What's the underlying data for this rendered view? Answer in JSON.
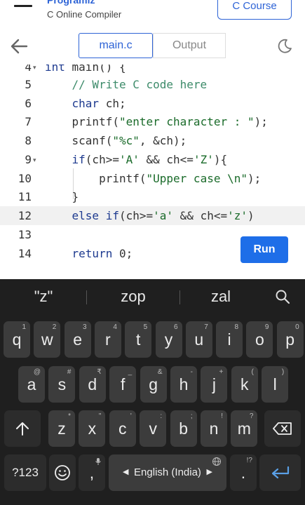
{
  "header": {
    "brand": "Programiz",
    "subtitle": "C Online Compiler",
    "course_button": "C Course"
  },
  "tabs": {
    "main": "main.c",
    "output": "Output"
  },
  "editor": {
    "lines": [
      {
        "n": "4",
        "fold": "▾",
        "code": "int main() {"
      },
      {
        "n": "5",
        "code": "    // Write C code here"
      },
      {
        "n": "6",
        "code": "    char ch;"
      },
      {
        "n": "7",
        "code": "    printf(\"enter character : \");"
      },
      {
        "n": "8",
        "code": "    scanf(\"%c\", &ch);"
      },
      {
        "n": "9",
        "fold": "▾",
        "code": "    if(ch>='A' && ch<='Z'){"
      },
      {
        "n": "10",
        "code": "        printf(\"Upper case \\n\");"
      },
      {
        "n": "11",
        "code": "    }"
      },
      {
        "n": "12",
        "code": "    else if(ch>='a' && ch<='z')"
      },
      {
        "n": "13",
        "code": ""
      },
      {
        "n": "14",
        "code": "    return 0;"
      }
    ]
  },
  "run_button": "Run",
  "keyboard": {
    "suggestions": [
      "\"z\"",
      "zop",
      "zal"
    ],
    "row1": [
      {
        "k": "q",
        "s": "1"
      },
      {
        "k": "w",
        "s": "2"
      },
      {
        "k": "e",
        "s": "3"
      },
      {
        "k": "r",
        "s": "4"
      },
      {
        "k": "t",
        "s": "5"
      },
      {
        "k": "y",
        "s": "6"
      },
      {
        "k": "u",
        "s": "7"
      },
      {
        "k": "i",
        "s": "8"
      },
      {
        "k": "o",
        "s": "9"
      },
      {
        "k": "p",
        "s": "0"
      }
    ],
    "row2": [
      {
        "k": "a",
        "s": "@"
      },
      {
        "k": "s",
        "s": "#"
      },
      {
        "k": "d",
        "s": "₹"
      },
      {
        "k": "f",
        "s": "_"
      },
      {
        "k": "g",
        "s": "&"
      },
      {
        "k": "h",
        "s": "-"
      },
      {
        "k": "j",
        "s": "+"
      },
      {
        "k": "k",
        "s": "("
      },
      {
        "k": "l",
        "s": ")"
      }
    ],
    "row3": [
      {
        "k": "z",
        "s": "*"
      },
      {
        "k": "x",
        "s": "\""
      },
      {
        "k": "c",
        "s": "'"
      },
      {
        "k": "v",
        "s": ":"
      },
      {
        "k": "b",
        "s": ";"
      },
      {
        "k": "n",
        "s": "!"
      },
      {
        "k": "m",
        "s": "?"
      }
    ],
    "sym_key": "?123",
    "comma": ",",
    "space_label": "English (India)",
    "period": ".",
    "period_sup": "!?"
  }
}
